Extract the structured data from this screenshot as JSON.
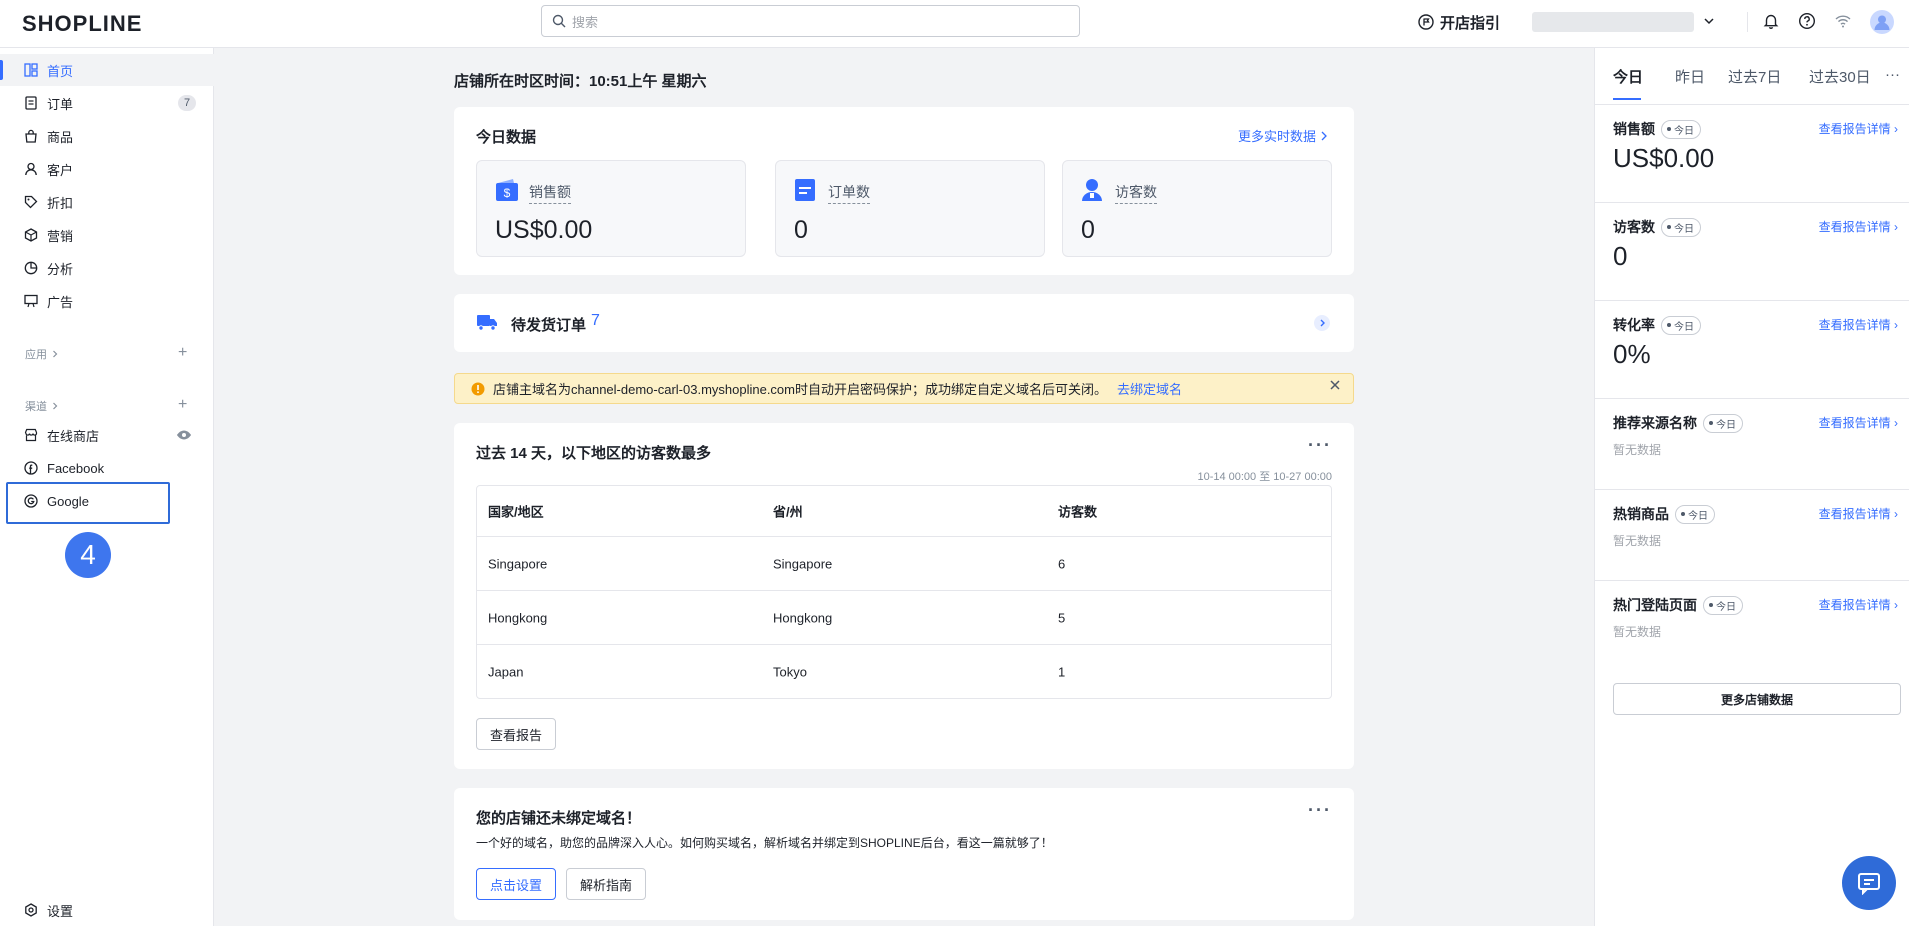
{
  "header": {
    "logo": "SHOPLINE",
    "search_placeholder": "搜索",
    "guide_label": "开店指引"
  },
  "sidebar": {
    "items": [
      {
        "label": "首页"
      },
      {
        "label": "订单",
        "badge": "7"
      },
      {
        "label": "商品"
      },
      {
        "label": "客户"
      },
      {
        "label": "折扣"
      },
      {
        "label": "营销"
      },
      {
        "label": "分析"
      },
      {
        "label": "广告"
      }
    ],
    "apps_label": "应用",
    "channels_label": "渠道",
    "channels": [
      {
        "label": "在线商店"
      },
      {
        "label": "Facebook"
      },
      {
        "label": "Google"
      }
    ],
    "step_number": "4",
    "settings_label": "设置"
  },
  "main": {
    "store_time": "店铺所在时区时间：10:51上午 星期六",
    "today": {
      "title": "今日数据",
      "more_link": "更多实时数据",
      "stats": [
        {
          "label": "销售额",
          "value": "US$0.00"
        },
        {
          "label": "订单数",
          "value": "0"
        },
        {
          "label": "访客数",
          "value": "0"
        }
      ]
    },
    "pending": {
      "label": "待发货订单",
      "count": "7"
    },
    "banner": {
      "text": "店铺主域名为channel-demo-carl-03.myshopline.com时自动开启密码保护；成功绑定自定义域名后可关闭。",
      "link": "去绑定域名"
    },
    "regions": {
      "title": "过去 14 天，以下地区的访客数最多",
      "date_range": "10-14 00:00 至 10-27 00:00",
      "columns": [
        "国家/地区",
        "省/州",
        "访客数"
      ],
      "rows": [
        [
          "Singapore",
          "Singapore",
          "6"
        ],
        [
          "Hongkong",
          "Hongkong",
          "5"
        ],
        [
          "Japan",
          "Tokyo",
          "1"
        ]
      ],
      "button": "查看报告"
    },
    "domain": {
      "title": "您的店铺还未绑定域名！",
      "desc": "一个好的域名，助您的品牌深入人心。如何购买域名，解析域名并绑定到SHOPLINE后台，看这一篇就够了！",
      "primary_button": "点击设置",
      "secondary_button": "解析指南"
    }
  },
  "right_panel": {
    "tabs": [
      "今日",
      "昨日",
      "过去7日",
      "过去30日"
    ],
    "tab_more": "···",
    "pill": "今日",
    "link_label": "查看报告详情",
    "sections": [
      {
        "title": "销售额",
        "value": "US$0.00"
      },
      {
        "title": "访客数",
        "value": "0"
      },
      {
        "title": "转化率",
        "value": "0%"
      },
      {
        "title": "推荐来源名称",
        "empty": "暂无数据"
      },
      {
        "title": "热销商品",
        "empty": "暂无数据"
      },
      {
        "title": "热门登陆页面",
        "empty": "暂无数据"
      }
    ],
    "more_button": "更多店铺数据"
  },
  "colors": {
    "accent": "#356dff",
    "banner_bg": "#fdf1c8",
    "annotation_blue": "#2f6bd8"
  }
}
